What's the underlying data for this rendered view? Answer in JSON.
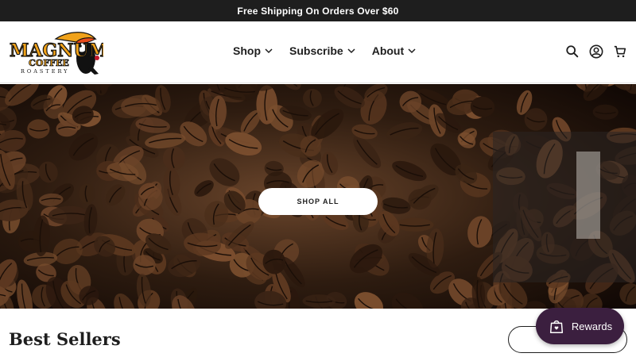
{
  "announcement": {
    "text": "Free Shipping On Orders Over $60"
  },
  "logo": {
    "line1": "MAGNUM",
    "line2": "COFFEE",
    "line3": "ROASTERY"
  },
  "nav": {
    "items": [
      {
        "label": "Shop"
      },
      {
        "label": "Subscribe"
      },
      {
        "label": "About"
      }
    ]
  },
  "header_icons": [
    "search-icon",
    "account-icon",
    "cart-icon"
  ],
  "hero": {
    "button_label": "SHOP ALL"
  },
  "best_sellers": {
    "title": "Best Sellers",
    "view_all_label": ""
  },
  "rewards": {
    "label": "Rewards"
  },
  "colors": {
    "announcement_bg": "#1e1e1e",
    "rewards_bg": "#3b1f3f",
    "text": "#1e1e1e"
  }
}
